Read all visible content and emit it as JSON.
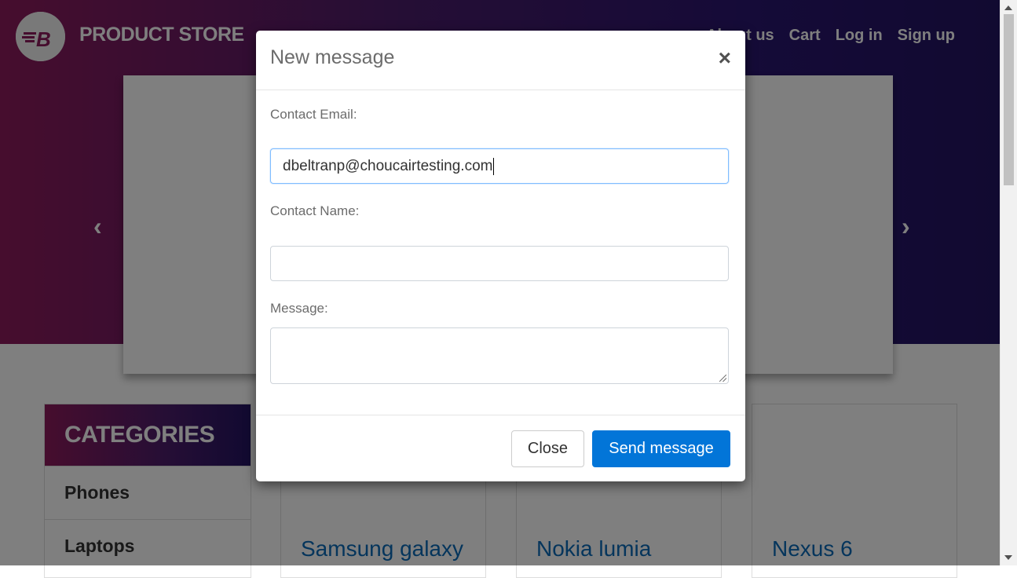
{
  "navbar": {
    "brand": "PRODUCT STORE",
    "links": [
      "About us",
      "Cart",
      "Log in",
      "Sign up"
    ]
  },
  "carousel": {
    "prev_glyph": "‹",
    "next_glyph": "›"
  },
  "categories": {
    "header": "CATEGORIES",
    "items": [
      "Phones",
      "Laptops"
    ]
  },
  "products": [
    "Samsung galaxy",
    "Nokia lumia",
    "Nexus 6"
  ],
  "modal": {
    "title": "New message",
    "close_glyph": "×",
    "email_label": "Contact Email:",
    "email_value": "dbeltranp@choucairtesting.com",
    "name_label": "Contact Name:",
    "name_value": "",
    "message_label": "Message:",
    "message_value": "",
    "close_button": "Close",
    "send_button": "Send message"
  },
  "colors": {
    "primary": "#0275d8",
    "product_link": "#0a6bb8",
    "nav_gradient_start": "#8d1a5c",
    "nav_gradient_end": "#231462"
  }
}
